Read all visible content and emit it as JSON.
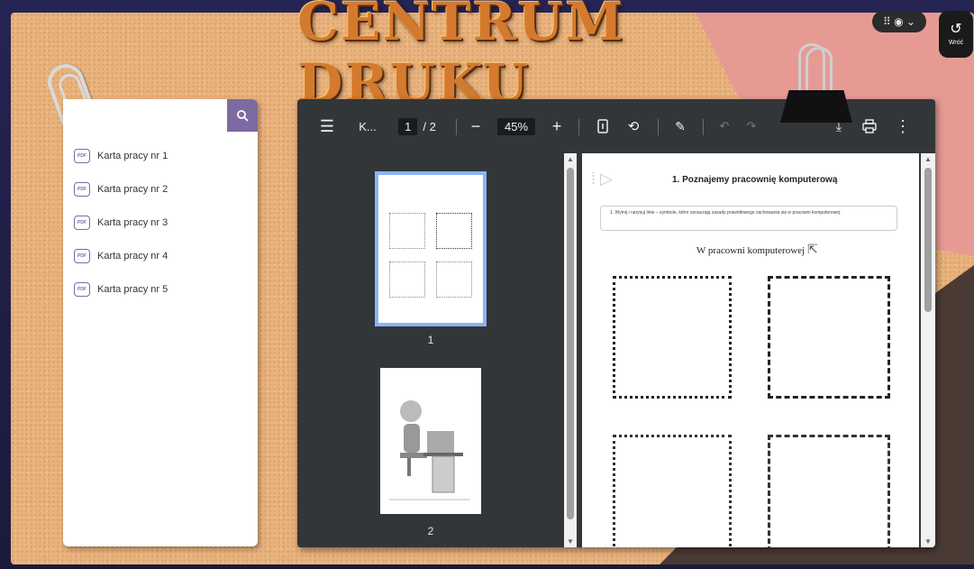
{
  "header": {
    "title": "CENTRUM DRUKU"
  },
  "top_controls": {
    "pill_glyph": "⠿ ◉ ⌄",
    "back_glyph": "↺",
    "back_label": "Wróć"
  },
  "sidebar": {
    "search_placeholder": "",
    "items": [
      {
        "label": "Karta pracy nr 1"
      },
      {
        "label": "Karta pracy nr 2"
      },
      {
        "label": "Karta pracy nr 3"
      },
      {
        "label": "Karta pracy nr 4"
      },
      {
        "label": "Karta pracy nr 5"
      }
    ],
    "pdf_badge": "PDF"
  },
  "viewer": {
    "doc_title": "K...",
    "page_current": "1",
    "page_total": "/ 2",
    "zoom": "45%",
    "thumbnails": [
      {
        "label": "1"
      },
      {
        "label": "2"
      }
    ],
    "page": {
      "exercise_number": "1.",
      "exercise_title": "Poznajemy pracownię komputerową",
      "instruction": "1. Wytnij i narysuj linie – symbole, które oznaczają zasady prawidłowego zachowania się w pracowni komputerowej.",
      "subtitle": "W pracowni komputerowej"
    }
  }
}
